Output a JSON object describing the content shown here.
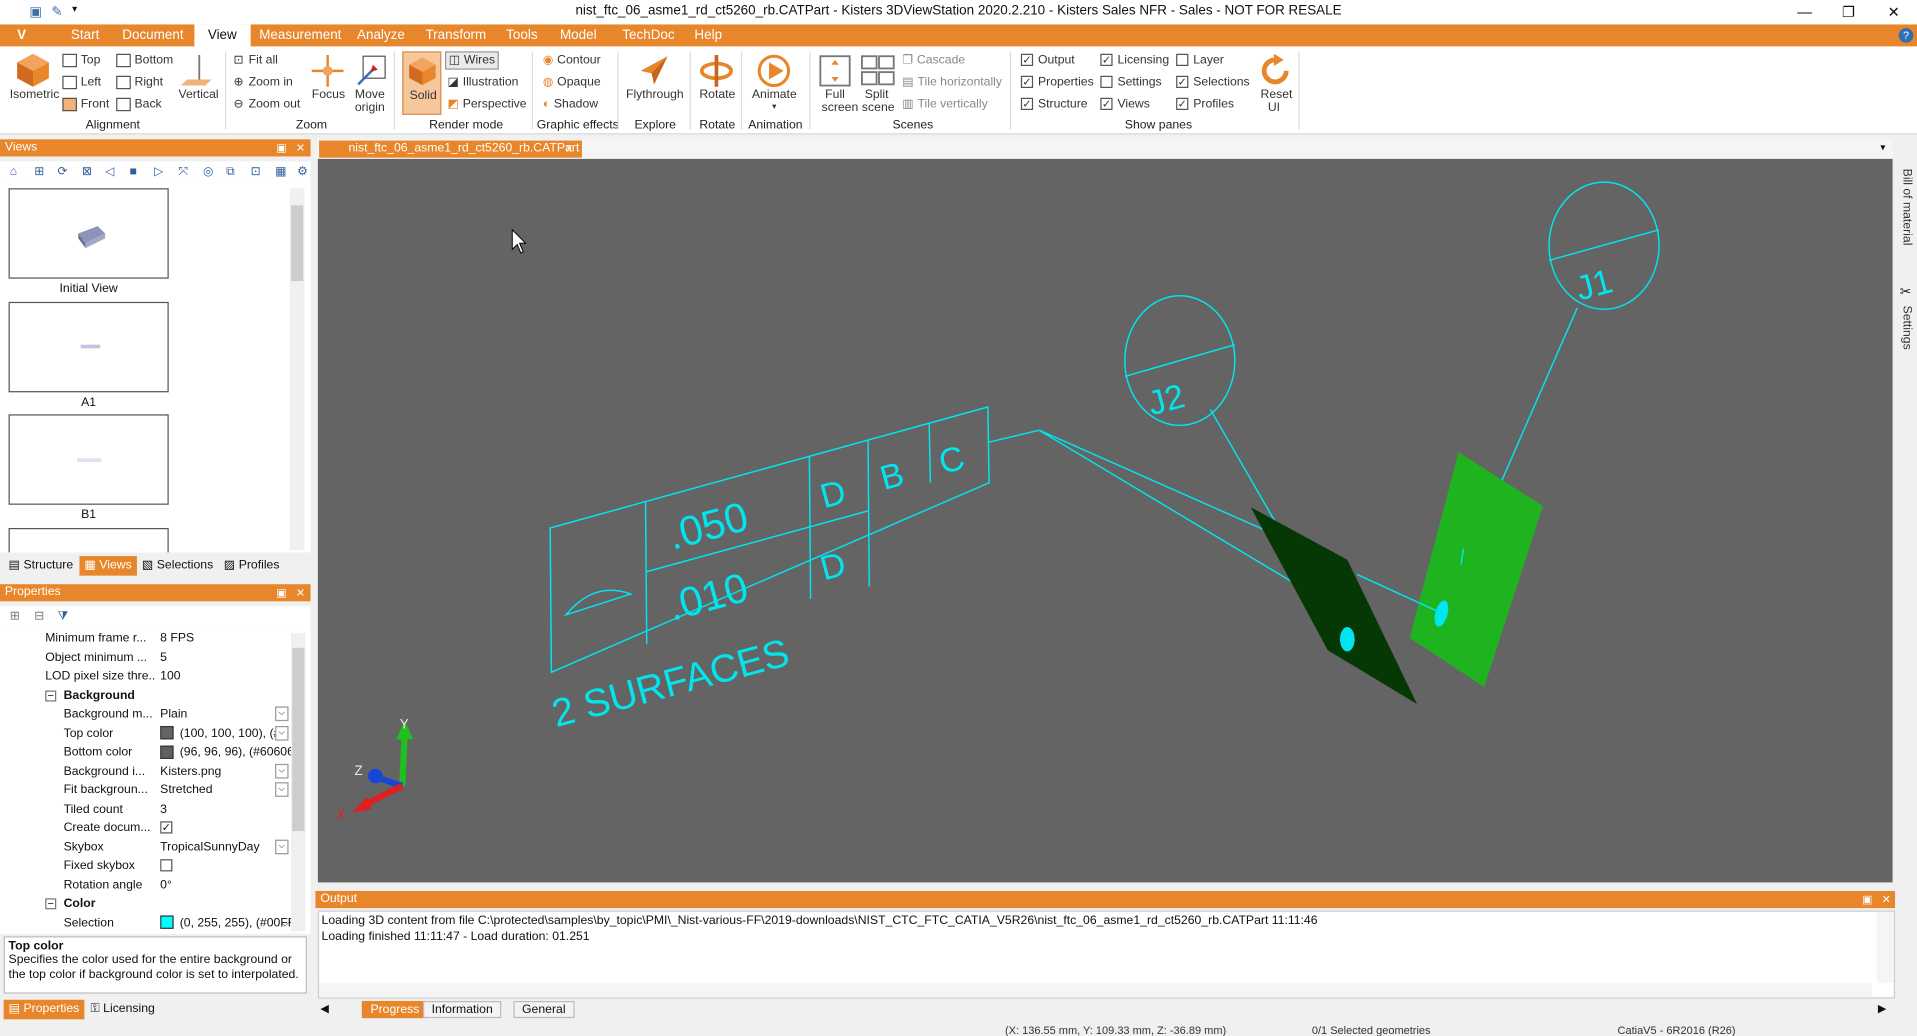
{
  "titlebar": {
    "title": "nist_ftc_06_asme1_rd_ct5260_rb.CATPart - Kisters 3DViewStation 2020.2.210 - Kisters Sales NFR - Sales - NOT FOR RESALE",
    "min": "—",
    "max": "❐",
    "close": "✕"
  },
  "tabs": {
    "v": "V",
    "start": "Start",
    "document": "Document",
    "view": "View",
    "measurement": "Measurement",
    "analyze": "Analyze",
    "transform": "Transform",
    "tools": "Tools",
    "model": "Model",
    "techdoc": "TechDoc",
    "help": "Help",
    "helpicon": "?"
  },
  "ribbon": {
    "isometric": "Isometric",
    "top": "Top",
    "bottom": "Bottom",
    "left": "Left",
    "right": "Right",
    "front": "Front",
    "back": "Back",
    "vertical": "Vertical",
    "alignment": "Alignment",
    "fitall": "Fit all",
    "zoomin": "Zoom in",
    "zoomout": "Zoom out",
    "focus": "Focus",
    "move": "Move",
    "origin": "origin",
    "zoom": "Zoom",
    "solid": "Solid",
    "wires": "Wires",
    "illustration": "Illustration",
    "perspective": "Perspective",
    "rendermode": "Render mode",
    "contour": "Contour",
    "opaque": "Opaque",
    "shadow": "Shadow",
    "graphiceffects": "Graphic effects",
    "flythrough": "Flythrough",
    "explore": "Explore",
    "rotate": "Rotate",
    "rotategrp": "Rotate",
    "animate": "Animate",
    "animation": "Animation",
    "full": "Full",
    "screen": "screen",
    "split": "Split",
    "scene": "scene",
    "cascade": "Cascade",
    "tileh": "Tile horizontally",
    "tilev": "Tile vertically",
    "scenes": "Scenes",
    "output": "Output",
    "licensing": "Licensing",
    "layer": "Layer",
    "properties": "Properties",
    "settings": "Settings",
    "selections": "Selections",
    "structure": "Structure",
    "views": "Views",
    "profiles": "Profiles",
    "showpanes": "Show panes",
    "reset": "Reset",
    "ui": "UI"
  },
  "views_panel": {
    "title": "Views",
    "items": [
      {
        "label": "Initial View"
      },
      {
        "label": "A1"
      },
      {
        "label": "B1"
      }
    ],
    "tabs": {
      "structure": "Structure",
      "views": "Views",
      "selections": "Selections",
      "profiles": "Profiles"
    }
  },
  "properties_panel": {
    "title": "Properties",
    "rows": [
      {
        "k": "Minimum frame r...",
        "v": "8 FPS"
      },
      {
        "k": "Object minimum ...",
        "v": "5"
      },
      {
        "k": "LOD pixel size thre...",
        "v": "100"
      },
      {
        "k": "Background",
        "v": ""
      },
      {
        "k": "Background m...",
        "v": "Plain"
      },
      {
        "k": "Top color",
        "v": "(100, 100, 100), (#6"
      },
      {
        "k": "Bottom color",
        "v": "(96, 96, 96), (#606060"
      },
      {
        "k": "Background i...",
        "v": "Kisters.png"
      },
      {
        "k": "Fit backgroun...",
        "v": "Stretched"
      },
      {
        "k": "Tiled count",
        "v": "3"
      },
      {
        "k": "Create docum...",
        "v": ""
      },
      {
        "k": "Skybox",
        "v": "TropicalSunnyDay"
      },
      {
        "k": "Fixed skybox",
        "v": ""
      },
      {
        "k": "Rotation angle",
        "v": "0°"
      },
      {
        "k": "Color",
        "v": ""
      },
      {
        "k": "Selection",
        "v": "(0, 255, 255), (#00FFF"
      }
    ],
    "help_title": "Top color",
    "help_text": "Specifies the color used for the entire background or the top color if background color is set to interpolated.",
    "tabs": {
      "properties": "Properties",
      "licensing": "Licensing"
    }
  },
  "document": {
    "tab": "nist_ftc_06_asme1_rd_ct5260_rb.CATPart",
    "close": "x"
  },
  "scene": {
    "fcf_row1_value": ".050",
    "fcf_row1_d1": "D",
    "fcf_row1_d2": "B",
    "fcf_row1_d3": "C",
    "fcf_row2_value": ".010",
    "fcf_row2_d1": "D",
    "note": "2 SURFACES",
    "j1": "J1",
    "j2": "J2",
    "axis_x": "X",
    "axis_y": "Y",
    "axis_z": "Z",
    "colors": {
      "background": "#646464",
      "annotation": "#00e5ee",
      "face_light": "#1fb41f",
      "face_dark": "#063806"
    }
  },
  "output_panel": {
    "title": "Output",
    "line1": "Loading 3D content from file C:\\protected\\samples\\by_topic\\PMI\\_Nist-various-FF\\2019-downloads\\NIST_CTC_FTC_CATIA_V5R26\\nist_ftc_06_asme1_rd_ct5260_rb.CATPart 11:11:46",
    "line2": "Loading finished 11:11:47 - Load duration: 01.251",
    "tabs": {
      "progress": "Progress",
      "information": "Information",
      "general": "General"
    }
  },
  "statusbar": {
    "coords": "(X: 136.55 mm, Y: 109.33 mm, Z: -36.89 mm)",
    "selected": "0/1 Selected geometries",
    "format": "CatiaV5 - 6R2016 (R26)"
  },
  "sidebar_right": {
    "bom": "Bill of material",
    "settings": "Settings"
  }
}
